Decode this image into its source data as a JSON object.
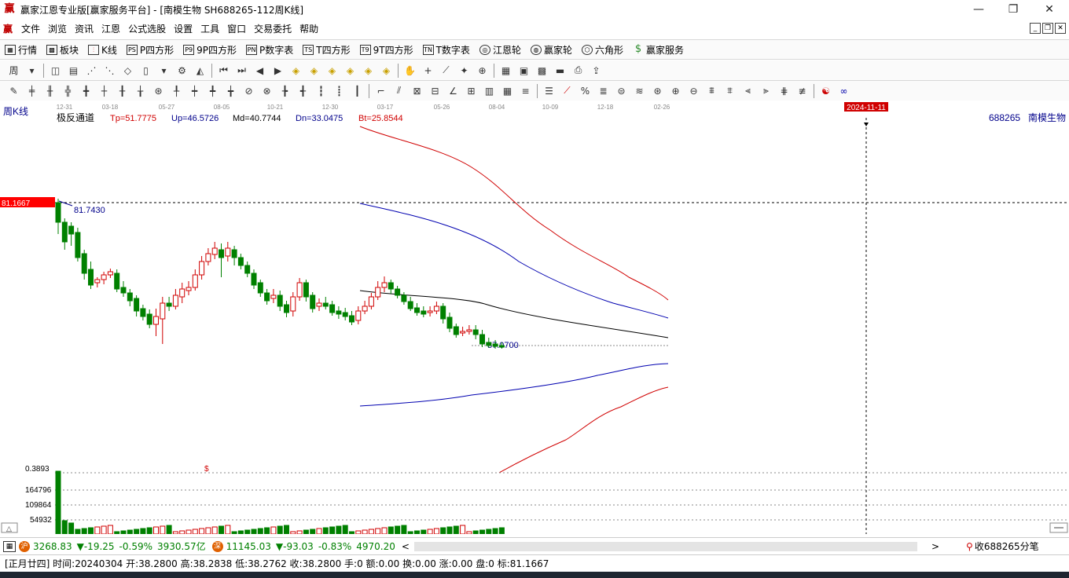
{
  "window": {
    "title": "赢家江恩专业版[赢家服务平台] - [南模生物  SH688265-112周K线]",
    "app_logo": "赢"
  },
  "menubar": {
    "logo": "赢",
    "items": [
      "文件",
      "浏览",
      "资讯",
      "江恩",
      "公式选股",
      "设置",
      "工具",
      "窗口",
      "交易委托",
      "帮助"
    ]
  },
  "funcbar": {
    "items": [
      {
        "icon": "▦",
        "label": "行情"
      },
      {
        "icon": "▩",
        "label": "板块"
      },
      {
        "icon": "⫶",
        "label": "K线"
      },
      {
        "icon": "PS",
        "label": "P四方形"
      },
      {
        "icon": "P9",
        "label": "9P四方形"
      },
      {
        "icon": "PN",
        "label": "P数字表"
      },
      {
        "icon": "TS",
        "label": "T四方形"
      },
      {
        "icon": "T9",
        "label": "9T四方形"
      },
      {
        "icon": "TN",
        "label": "T数字表"
      },
      {
        "icon": "◎",
        "label": "江恩轮"
      },
      {
        "icon": "◍",
        "label": "赢家轮"
      },
      {
        "icon": "⬡",
        "label": "六角形"
      },
      {
        "icon": "$",
        "label": "赢家服务"
      }
    ]
  },
  "chart": {
    "period_label": "周K线",
    "date_ticks": [
      "12-31",
      "03-18",
      "05-27",
      "08-05",
      "10-21",
      "12-30",
      "03-17",
      "05-26",
      "08-04",
      "10-09",
      "12-18",
      "02-26"
    ],
    "cursor_date": "2024-11-11",
    "indicator_name": "极反通道",
    "tp": "Tp=51.7775",
    "up": "Up=46.5726",
    "md": "Md=40.7744",
    "dn": "Dn=33.0475",
    "bt": "Bt=25.8544",
    "stock_id": "688265",
    "stock_name": "南模生物",
    "price_label": "81.1667",
    "high_label": "81.7430",
    "last_label": "37.0700",
    "vol_max": "0.3893",
    "vol_tick1": "164796",
    "vol_tick2": "109864",
    "vol_tick3": "54932",
    "dollar_marker": "$",
    "colors": {
      "up": "#d00000",
      "down": "#008000",
      "channel_outer": "#d00000",
      "channel_inner": "#0000b0",
      "channel_mid": "#000000",
      "cursor_date_bg": "#d00000"
    }
  },
  "indexbar": {
    "sh_value": "3268.83",
    "sh_change": "▼-19.25",
    "sh_pct": "-0.59%",
    "sh_amount": "3930.57亿",
    "sz_value": "11145.03",
    "sz_change": "▼-93.03",
    "sz_pct": "-0.83%",
    "sz_amount": "4970.20",
    "right_label": "收688265分笔"
  },
  "statusbar": {
    "text": "[正月廿四] 时间:20240304 开:38.2800 高:38.2838 低:38.2762 收:38.2800 手:0 额:0.00 换:0.00 涨:0.00 盘:0 标:81.1667"
  }
}
